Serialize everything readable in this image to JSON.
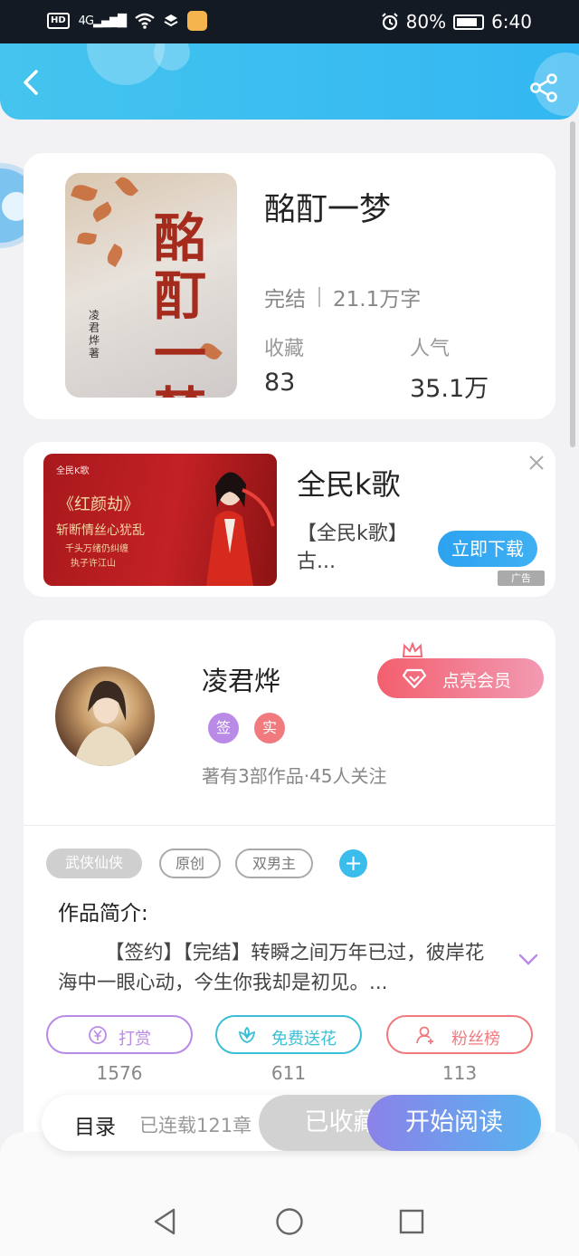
{
  "status_bar": {
    "hd": "HD",
    "signal": "4G",
    "battery_percent": "80%",
    "battery_level": 0.8,
    "time": "6:40"
  },
  "header": {
    "back_icon": "chevron-left-icon",
    "share_icon": "share-icon",
    "color": "#3ab9f0"
  },
  "book": {
    "cover_title": "酩酊一梦",
    "cover_author": "凌君烨著",
    "title": "酩酊一梦",
    "status": "完结",
    "word_count": "21.1万字",
    "favorites_label": "收藏",
    "favorites_value": "83",
    "popularity_label": "人气",
    "popularity_value": "35.1万"
  },
  "ad": {
    "image_logo": "全民K歌",
    "image_title": "《红颜劫》",
    "image_lines": [
      "斩断情丝心犹乱",
      "千头万绪仍纠缠",
      "执子许江山"
    ],
    "title": "全民k歌",
    "description": "【全民k歌】古...",
    "cta": "立即下载",
    "badge": "广告"
  },
  "author": {
    "name": "凌君烨",
    "vip_button": "点亮会员",
    "badges": [
      {
        "label": "签",
        "color": "#b98ae6"
      },
      {
        "label": "实",
        "color": "#f07a7e"
      }
    ],
    "summary": "著有3部作品·45人关注"
  },
  "tags": [
    {
      "label": "武侠仙侠",
      "style": "filled"
    },
    {
      "label": "原创",
      "style": "outline"
    },
    {
      "label": "双男主",
      "style": "outline"
    }
  ],
  "intro": {
    "label": "作品简介:",
    "text": "【签约】【完结】转瞬之间万年已过，彼岸花海中一眼心动，今生你我却是初见。..."
  },
  "actions": [
    {
      "label": "打赏",
      "count": "1576",
      "color": "#b98ae6",
      "icon": "coin-icon"
    },
    {
      "label": "免费送花",
      "count": "611",
      "color": "#3bbfd6",
      "icon": "flower-icon"
    },
    {
      "label": "粉丝榜",
      "count": "113",
      "color": "#f07a7e",
      "icon": "fans-icon"
    }
  ],
  "bottom_bar": {
    "toc": "目录",
    "status": "已连载121章",
    "collected": "已收藏",
    "start_reading": "开始阅读"
  }
}
